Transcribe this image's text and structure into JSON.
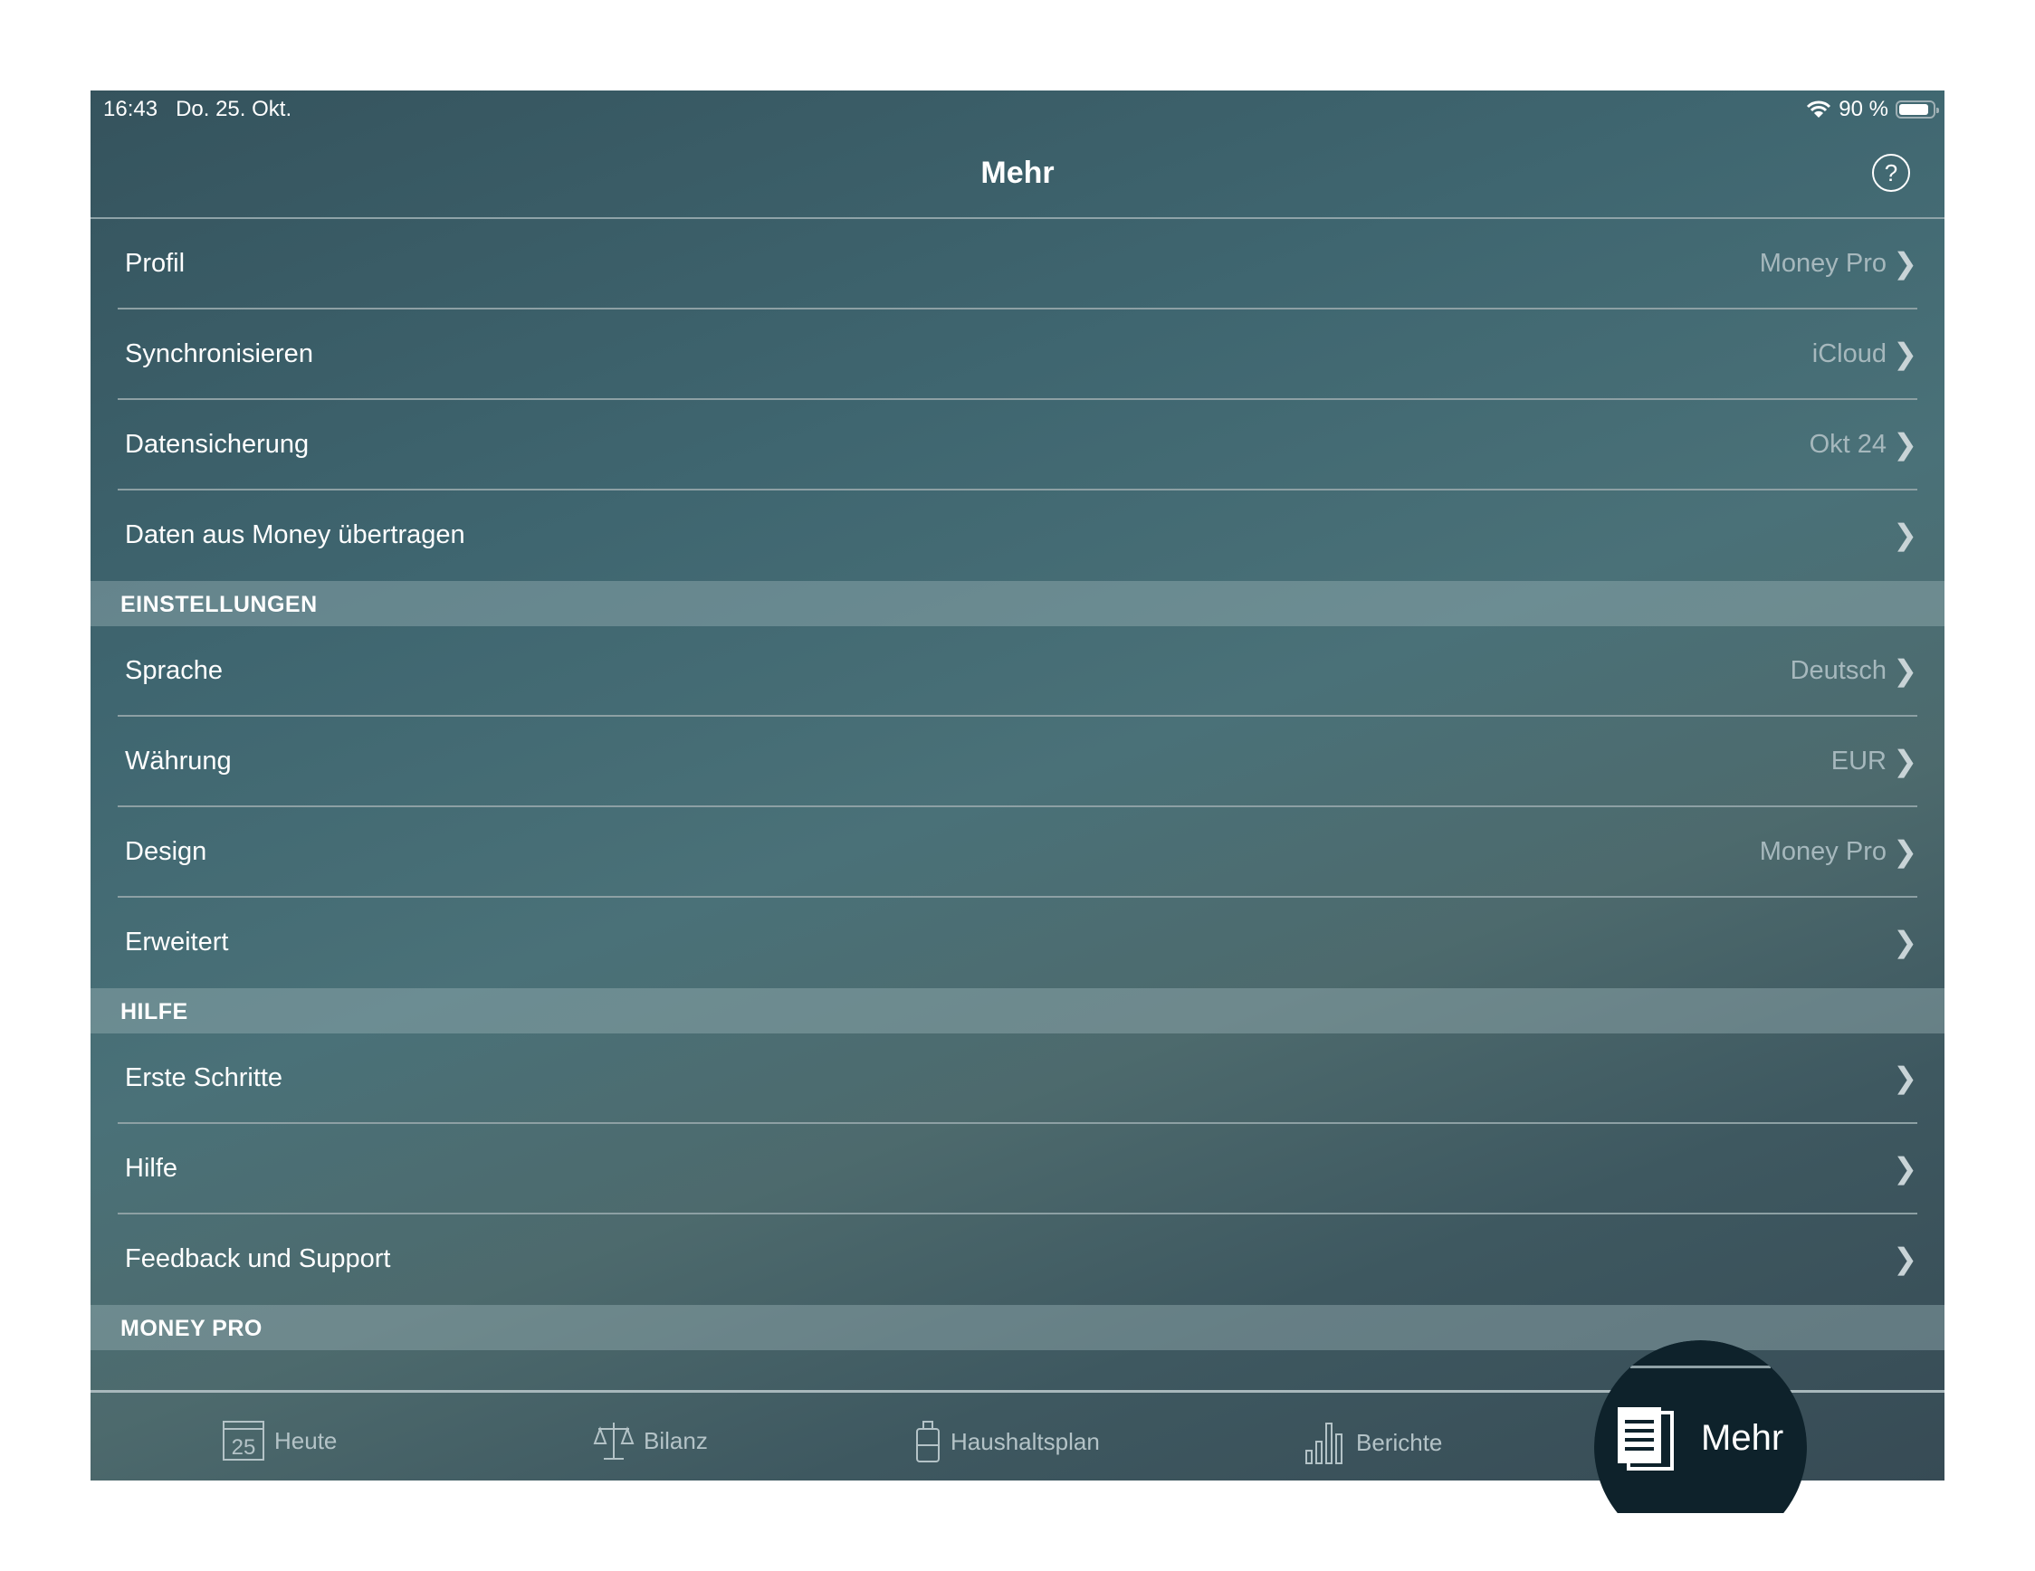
{
  "status_bar": {
    "time": "16:43",
    "date": "Do. 25. Okt.",
    "battery": "90 %",
    "battery_level": 0.9
  },
  "nav": {
    "title": "Mehr",
    "help_icon": "question-circle-icon",
    "help_label": "?"
  },
  "groups": [
    {
      "header": "",
      "items": [
        {
          "label": "Profil",
          "value": "Money Pro"
        },
        {
          "label": "Synchronisieren",
          "value": "iCloud"
        },
        {
          "label": "Datensicherung",
          "value": "Okt 24"
        },
        {
          "label": "Daten aus Money übertragen",
          "value": ""
        }
      ]
    },
    {
      "header": "EINSTELLUNGEN",
      "items": [
        {
          "label": "Sprache",
          "value": "Deutsch"
        },
        {
          "label": "Währung",
          "value": "EUR"
        },
        {
          "label": "Design",
          "value": "Money Pro"
        },
        {
          "label": "Erweitert",
          "value": ""
        }
      ]
    },
    {
      "header": "HILFE",
      "items": [
        {
          "label": "Erste Schritte",
          "value": ""
        },
        {
          "label": "Hilfe",
          "value": ""
        },
        {
          "label": "Feedback und Support",
          "value": ""
        }
      ]
    },
    {
      "header": "MONEY PRO",
      "items": []
    }
  ],
  "tabbar": {
    "tabs": [
      {
        "label": "Heute",
        "icon": "calendar-icon",
        "icon_text": "25"
      },
      {
        "label": "Bilanz",
        "icon": "scale-icon"
      },
      {
        "label": "Haushaltsplan",
        "icon": "jar-icon"
      },
      {
        "label": "Berichte",
        "icon": "bar-chart-icon"
      },
      {
        "label": "Mehr",
        "icon": "document-icon",
        "active": true
      }
    ]
  }
}
